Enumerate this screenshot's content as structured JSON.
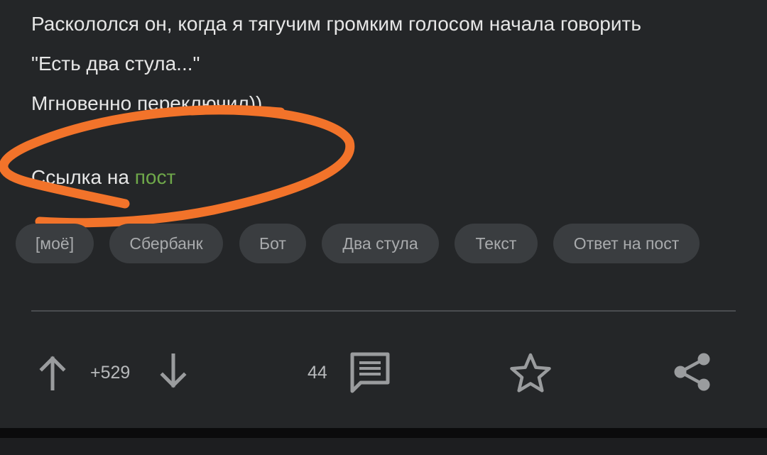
{
  "post": {
    "lines": [
      "Раскололся он, когда я тягучим громким голосом начала говорить",
      "\"Есть два стула...\"",
      "Мгновенно переключил))"
    ],
    "link_prefix": "Ссылка на ",
    "link_text": "пост"
  },
  "tags": [
    "[моё]",
    "Сбербанк",
    "Бот",
    "Два стула",
    "Текст",
    "Ответ на пост"
  ],
  "actions": {
    "rating": "+529",
    "comments_count": "44"
  },
  "colors": {
    "background": "#242628",
    "text": "#e6e6e6",
    "link": "#6fa84a",
    "tag_background": "#3a3d40",
    "tag_text": "#a9abad",
    "icon": "#9a9c9e",
    "annotation_stroke": "#f2732a"
  },
  "icons": {
    "upvote": "arrow-up-icon",
    "downvote": "arrow-down-icon",
    "comments": "comment-icon",
    "save": "star-icon",
    "share": "share-icon"
  }
}
